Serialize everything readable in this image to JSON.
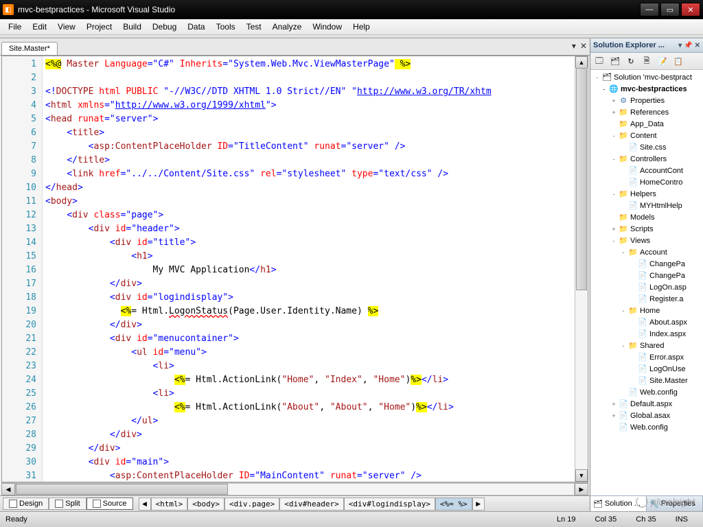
{
  "window_title": "mvc-bestpractices - Microsoft Visual Studio",
  "menu": [
    "File",
    "Edit",
    "View",
    "Project",
    "Build",
    "Debug",
    "Data",
    "Tools",
    "Test",
    "Analyze",
    "Window",
    "Help"
  ],
  "active_tab": "Site.Master*",
  "gutter_lines": [
    "1",
    "2",
    "3",
    "4",
    "5",
    "6",
    "7",
    "8",
    "9",
    "10",
    "11",
    "12",
    "13",
    "14",
    "15",
    "16",
    "17",
    "18",
    "19",
    "20",
    "21",
    "22",
    "23",
    "24",
    "25",
    "26",
    "27",
    "28",
    "29",
    "30",
    "31"
  ],
  "viewmodes": {
    "design": "Design",
    "split": "Split",
    "source": "Source"
  },
  "breadcrumbs": [
    "<html>",
    "<body>",
    "<div.page>",
    "<div#header>",
    "<div#logindisplay>",
    "<%= %>"
  ],
  "explorer": {
    "title": "Solution Explorer ...",
    "solution": "Solution 'mvc-bestpract",
    "project": "mvc-bestpractices",
    "nodes": [
      {
        "l": 2,
        "e": "+",
        "i": "⚙",
        "t": "Properties"
      },
      {
        "l": 2,
        "e": "+",
        "i": "📁",
        "t": "References"
      },
      {
        "l": 2,
        "e": "",
        "i": "📁",
        "t": "App_Data"
      },
      {
        "l": 2,
        "e": "-",
        "i": "📁",
        "t": "Content"
      },
      {
        "l": 3,
        "e": "",
        "i": "📄",
        "t": "Site.css"
      },
      {
        "l": 2,
        "e": "-",
        "i": "📁",
        "t": "Controllers"
      },
      {
        "l": 3,
        "e": "",
        "i": "📄",
        "t": "AccountCont"
      },
      {
        "l": 3,
        "e": "",
        "i": "📄",
        "t": "HomeContro"
      },
      {
        "l": 2,
        "e": "-",
        "i": "📁",
        "t": "Helpers"
      },
      {
        "l": 3,
        "e": "",
        "i": "📄",
        "t": "MYHtmlHelp"
      },
      {
        "l": 2,
        "e": "",
        "i": "📁",
        "t": "Models"
      },
      {
        "l": 2,
        "e": "+",
        "i": "📁",
        "t": "Scripts"
      },
      {
        "l": 2,
        "e": "-",
        "i": "📁",
        "t": "Views"
      },
      {
        "l": 3,
        "e": "-",
        "i": "📁",
        "t": "Account"
      },
      {
        "l": 4,
        "e": "",
        "i": "📄",
        "t": "ChangePa"
      },
      {
        "l": 4,
        "e": "",
        "i": "📄",
        "t": "ChangePa"
      },
      {
        "l": 4,
        "e": "",
        "i": "📄",
        "t": "LogOn.asp"
      },
      {
        "l": 4,
        "e": "",
        "i": "📄",
        "t": "Register.a"
      },
      {
        "l": 3,
        "e": "-",
        "i": "📁",
        "t": "Home"
      },
      {
        "l": 4,
        "e": "",
        "i": "📄",
        "t": "About.aspx"
      },
      {
        "l": 4,
        "e": "",
        "i": "📄",
        "t": "Index.aspx"
      },
      {
        "l": 3,
        "e": "-",
        "i": "📁",
        "t": "Shared"
      },
      {
        "l": 4,
        "e": "",
        "i": "📄",
        "t": "Error.aspx"
      },
      {
        "l": 4,
        "e": "",
        "i": "📄",
        "t": "LogOnUse"
      },
      {
        "l": 4,
        "e": "",
        "i": "📄",
        "t": "Site.Master"
      },
      {
        "l": 3,
        "e": "",
        "i": "📄",
        "t": "Web.config"
      },
      {
        "l": 2,
        "e": "+",
        "i": "📄",
        "t": "Default.aspx"
      },
      {
        "l": 2,
        "e": "+",
        "i": "📄",
        "t": "Global.asax"
      },
      {
        "l": 2,
        "e": "",
        "i": "📄",
        "t": "Web.config"
      }
    ]
  },
  "footer_tabs": {
    "solution": "Solution ...",
    "properties": "Properties"
  },
  "status": {
    "ready": "Ready",
    "ln": "Ln 19",
    "col": "Col 35",
    "ch": "Ch 35",
    "ins": "INS"
  },
  "logo": "pluralsight",
  "code": {
    "l1a": "<%@",
    "l1b": " Master ",
    "l1c": "Language",
    "l1d": "=\"C#\"",
    "l1e": " Inherits",
    "l1f": "=\"System.Web.Mvc.ViewMasterPage\"",
    "l1g": " %>",
    "l3a": "<!",
    "l3b": "DOCTYPE ",
    "l3c": "html ",
    "l3d": "PUBLIC ",
    "l3e": "\"-//W3C//DTD XHTML 1.0 Strict//EN\" ",
    "l3f": "\"",
    "l3g": "http://www.w3.org/TR/xhtm",
    "l4a": "<",
    "l4b": "html ",
    "l4c": "xmlns",
    "l4d": "=\"",
    "l4e": "http://www.w3.org/1999/xhtml",
    "l4f": "\">",
    "l5a": "<",
    "l5b": "head ",
    "l5c": "runat",
    "l5d": "=\"server\"",
    "l6": "title",
    "l7a": "asp",
    "l7b": ":ContentPlaceHolder ",
    "l7c": "ID",
    "l7d": "=\"TitleContent\"",
    "l7e": " runat",
    "l7f": "=\"server\"",
    "l7g": " />",
    "l9a": "link ",
    "l9b": "href",
    "l9c": "=\"../../Content/Site.css\"",
    "l9d": " rel",
    "l9e": "=\"stylesheet\"",
    "l9f": " type",
    "l9g": "=\"text/css\"",
    "l9h": " />",
    "l10": "head",
    "l11": "body",
    "l12a": "div ",
    "l12b": "class",
    "l12c": "=\"page\"",
    "l13a": "div ",
    "l13b": "id",
    "l13c": "=\"header\"",
    "l14c": "=\"title\"",
    "l15": "h1",
    "l16": "                    My MVC Application",
    "l17": "div",
    "l18c": "=\"logindisplay\"",
    "l19a": "<%",
    "l19b": "= Html.",
    "l19c": "LogonStatus",
    "l19d": "(Page.User.Identity.Name) ",
    "l19e": "%>",
    "l21c": "=\"menucontainer\"",
    "l22a": "ul ",
    "l22b": "id",
    "l22c": "=\"menu\"",
    "l23": "li",
    "l24a": "<%",
    "l24b": "= Html.ActionLink(",
    "l24c": "\"Home\"",
    "l24d": ", ",
    "l24e": "\"Index\"",
    "l24f": ", ",
    "l24g": "\"Home\"",
    "l24h": ")",
    "l24i": "%>",
    "l26c": "\"About\"",
    "l26e": "\"About\"",
    "l27": "ul",
    "l30c": "=\"main\"",
    "l31d": "=\"MainContent\""
  }
}
